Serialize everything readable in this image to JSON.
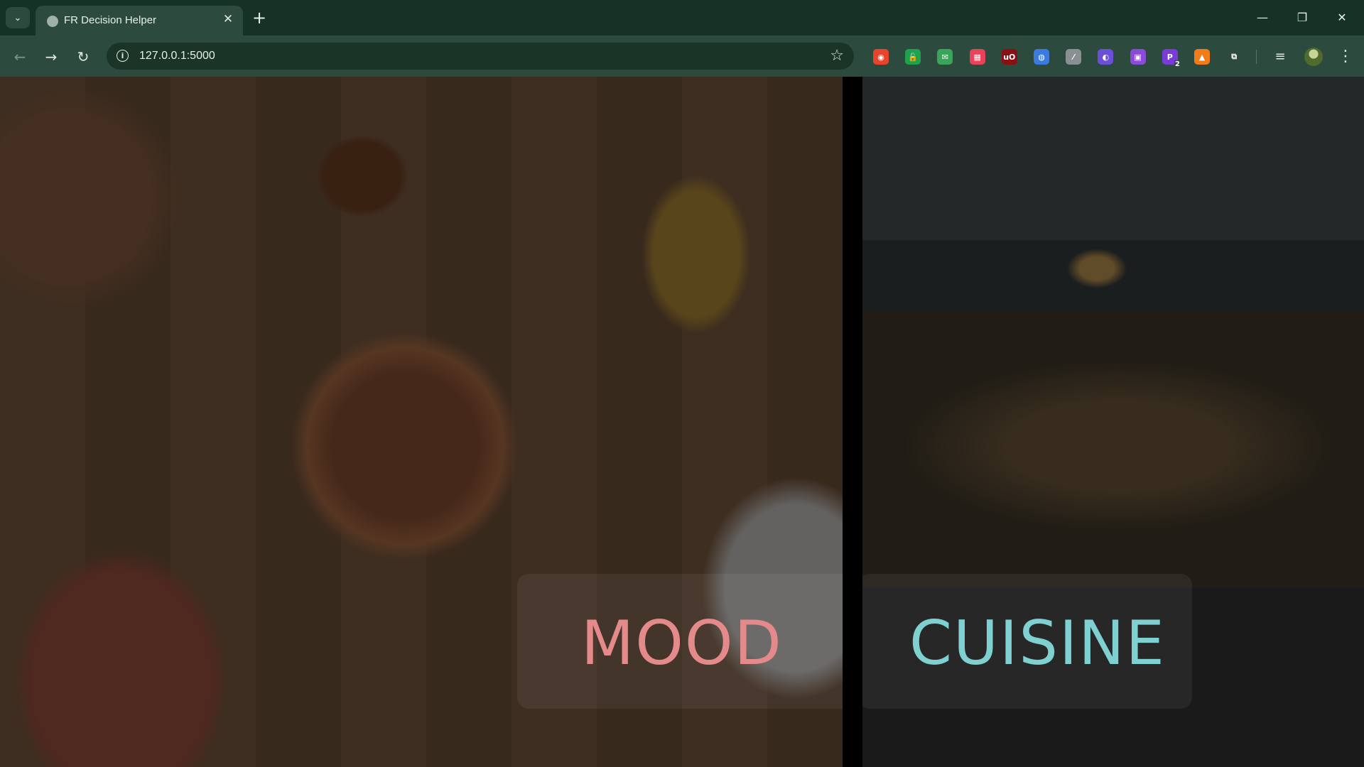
{
  "browser": {
    "tab": {
      "title": "FR Decision Helper",
      "close_glyph": "✕"
    },
    "new_tab_glyph": "+",
    "tab_search_glyph": "⌄",
    "window_controls": {
      "minimize": "—",
      "restore": "❐",
      "close": "✕"
    },
    "nav": {
      "back": "←",
      "forward": "→",
      "reload": "↻"
    },
    "address_bar": {
      "url": "127.0.0.1:5000",
      "info_glyph": "i",
      "star_glyph": "☆"
    },
    "extensions": [
      {
        "name": "extension-red-record-icon",
        "color": "#e8442c",
        "glyph": "◉"
      },
      {
        "name": "extension-green-lock-icon",
        "color": "#1fa34a",
        "glyph": "🔓"
      },
      {
        "name": "extension-mail-icon",
        "color": "#3aa55a",
        "glyph": "✉"
      },
      {
        "name": "extension-pink-calendar-icon",
        "color": "#e8435a",
        "glyph": "▦"
      },
      {
        "name": "extension-ublock-icon",
        "color": "#8a0f12",
        "glyph": "uO"
      },
      {
        "name": "extension-camera-icon",
        "color": "#3b7be0",
        "glyph": "◍"
      },
      {
        "name": "extension-gray-slash-icon",
        "color": "#8a8f93",
        "glyph": "⁄"
      },
      {
        "name": "extension-shield-icon",
        "color": "#6b4fd6",
        "glyph": "◐"
      },
      {
        "name": "extension-twitch-icon",
        "color": "#8a4bd8",
        "glyph": "▣"
      },
      {
        "name": "extension-purple-p-icon",
        "color": "#7a3cd8",
        "glyph": "P",
        "badge": "2"
      },
      {
        "name": "extension-orange-flame-icon",
        "color": "#f07c1a",
        "glyph": "▲"
      },
      {
        "name": "extensions-puzzle-icon",
        "color": "#2c4a3e",
        "glyph": "⧉"
      }
    ],
    "media_glyph": "≡",
    "menu_glyph": "⋮"
  },
  "page": {
    "panels": [
      {
        "id": "mood",
        "label": "MOOD",
        "label_color": "#e58a8a"
      },
      {
        "id": "cuisine",
        "label": "CUISINE",
        "label_color": "#7fd0d0"
      }
    ]
  }
}
